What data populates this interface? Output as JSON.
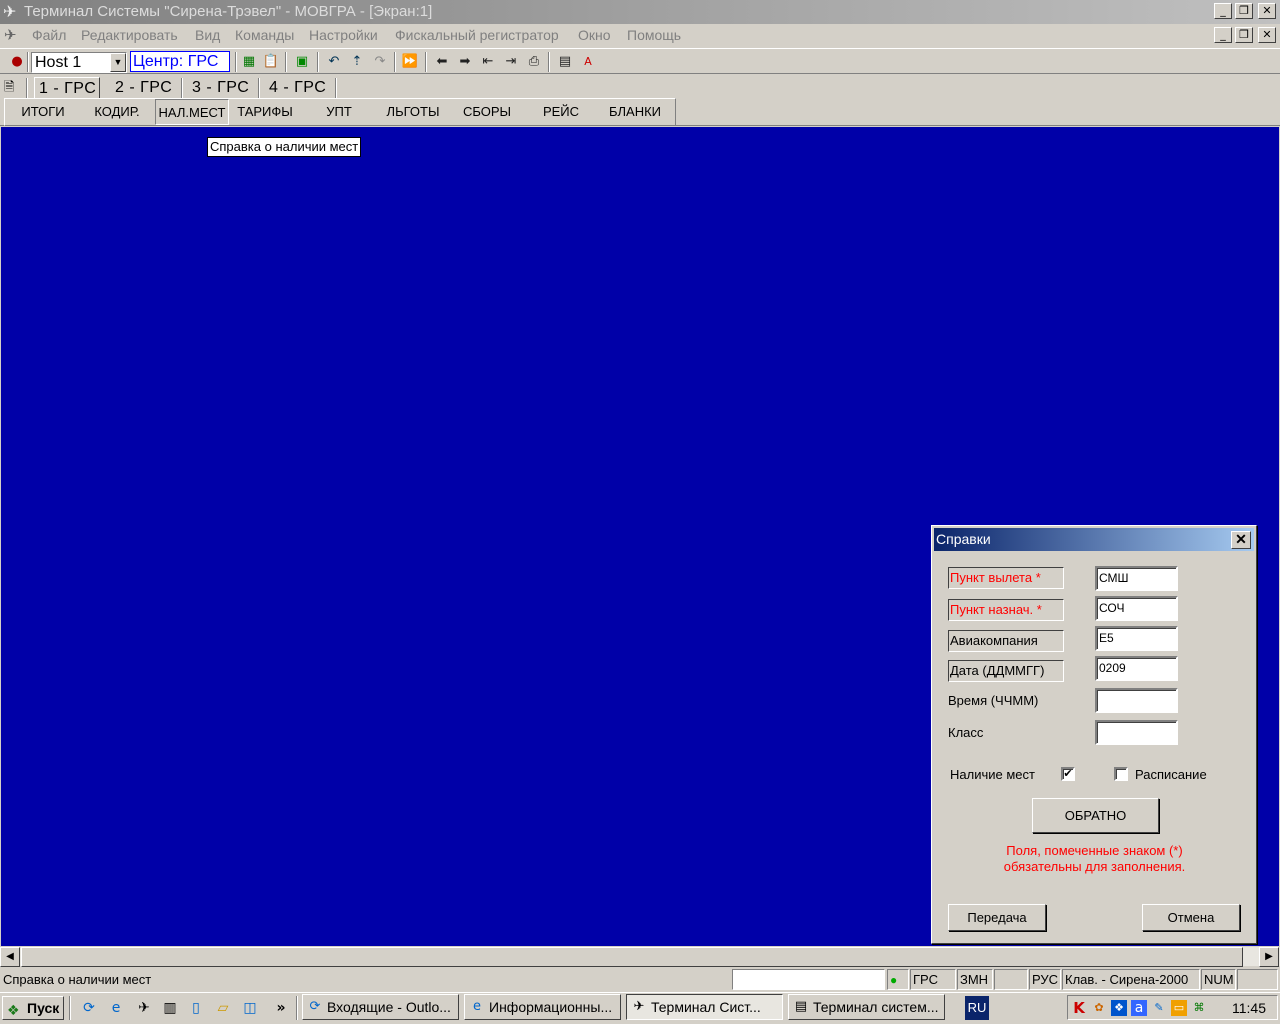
{
  "window": {
    "title": "Терминал Системы \"Сирена-Трэвел\" - МОВГРА - [Экран:1]",
    "controls": [
      "_",
      "❐",
      "✕"
    ]
  },
  "menu": [
    "Файл",
    "Редактировать",
    "Вид",
    "Команды",
    "Настройки",
    "Фискальный регистратор",
    "Окно",
    "Помощь"
  ],
  "toolbar": {
    "host": "Host 1",
    "center": "Центр: ГРС"
  },
  "tabs": [
    "1 - ГРС",
    "2 - ГРС",
    "3 - ГРС",
    "4 - ГРС"
  ],
  "functions": [
    "ИТОГИ",
    "КОДИР.",
    "НАЛ.МЕСТ",
    "ТАРИФЫ",
    "УПТ",
    "ЛЬГОТЫ",
    "СБОРЫ",
    "РЕЙС",
    "БЛАНКИ"
  ],
  "tooltip": "Справка о наличии мест",
  "dialog": {
    "title": "Справки",
    "fields": [
      {
        "label": "Пункт вылета *",
        "value": "СМШ",
        "required": true
      },
      {
        "label": "Пункт назнач. *",
        "value": "СОЧ",
        "required": true
      },
      {
        "label": "Авиакомпания",
        "value": "E5",
        "required": false
      },
      {
        "label": "Дата (ДДММГГ)",
        "value": "0209",
        "required": false
      },
      {
        "label": "Время (ЧЧММ)",
        "value": "",
        "required": false
      },
      {
        "label": "Класс",
        "value": "",
        "required": false
      }
    ],
    "availability_label": "Наличие мест",
    "availability_checked": true,
    "schedule_label": "Расписание",
    "schedule_checked": false,
    "back_button": "ОБРАТНО",
    "note_line1": "Поля, помеченные знаком (*)",
    "note_line2": "обязательны для заполнения.",
    "send_button": "Передача",
    "cancel_button": "Отмена"
  },
  "status": {
    "message": "Справка о наличии мест",
    "system": "ГРС",
    "zone": "ЗМН",
    "lang": "РУС",
    "keyboard": "Клав. - Сирена-2000",
    "num": "NUM"
  },
  "taskbar": {
    "start": "Пуск",
    "more": "»",
    "tasks": [
      "Входящие - Outlo...",
      "Информационны...",
      "Терминал Сист...",
      "Терминал систем..."
    ],
    "active_task": 2,
    "lang": "RU",
    "clock": "11:45"
  },
  "colors": {
    "terminal_bg": "#0000a8",
    "required_label": "#ff0000",
    "dialog_title_start": "#0a246a",
    "dialog_title_end": "#a6caf0"
  }
}
